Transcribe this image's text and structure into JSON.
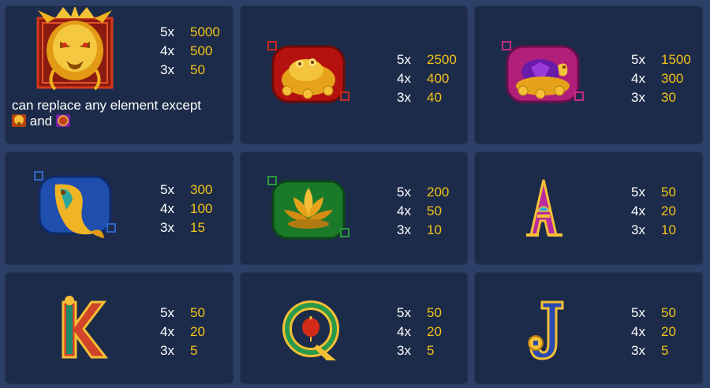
{
  "paytable": {
    "cards": [
      {
        "symbol": "dragon-wild-icon",
        "pays": [
          {
            "count": "5x",
            "value": "5000"
          },
          {
            "count": "4x",
            "value": "500"
          },
          {
            "count": "3x",
            "value": "50"
          }
        ],
        "note": {
          "text_before": "can replace any element except",
          "text_middle": "and",
          "icons": [
            "gold-tree-icon",
            "purple-bonus-icon"
          ]
        }
      },
      {
        "symbol": "golden-toad-icon",
        "pays": [
          {
            "count": "5x",
            "value": "2500"
          },
          {
            "count": "4x",
            "value": "400"
          },
          {
            "count": "3x",
            "value": "40"
          }
        ]
      },
      {
        "symbol": "golden-turtle-icon",
        "pays": [
          {
            "count": "5x",
            "value": "1500"
          },
          {
            "count": "4x",
            "value": "300"
          },
          {
            "count": "3x",
            "value": "30"
          }
        ]
      },
      {
        "symbol": "golden-koi-fish-icon",
        "pays": [
          {
            "count": "5x",
            "value": "300"
          },
          {
            "count": "4x",
            "value": "100"
          },
          {
            "count": "3x",
            "value": "15"
          }
        ]
      },
      {
        "symbol": "golden-lotus-icon",
        "pays": [
          {
            "count": "5x",
            "value": "200"
          },
          {
            "count": "4x",
            "value": "50"
          },
          {
            "count": "3x",
            "value": "10"
          }
        ]
      },
      {
        "symbol": "letter-a-icon",
        "pays": [
          {
            "count": "5x",
            "value": "50"
          },
          {
            "count": "4x",
            "value": "20"
          },
          {
            "count": "3x",
            "value": "10"
          }
        ]
      },
      {
        "symbol": "letter-k-icon",
        "pays": [
          {
            "count": "5x",
            "value": "50"
          },
          {
            "count": "4x",
            "value": "20"
          },
          {
            "count": "3x",
            "value": "5"
          }
        ]
      },
      {
        "symbol": "letter-q-icon",
        "pays": [
          {
            "count": "5x",
            "value": "50"
          },
          {
            "count": "4x",
            "value": "20"
          },
          {
            "count": "3x",
            "value": "5"
          }
        ]
      },
      {
        "symbol": "letter-j-icon",
        "pays": [
          {
            "count": "5x",
            "value": "50"
          },
          {
            "count": "4x",
            "value": "20"
          },
          {
            "count": "3x",
            "value": "5"
          }
        ]
      }
    ]
  },
  "colors": {
    "background": "#2c3f66",
    "card": "#1d2b4a",
    "multiplier_text": "#ffffff",
    "payout_text": "#f2c318"
  }
}
